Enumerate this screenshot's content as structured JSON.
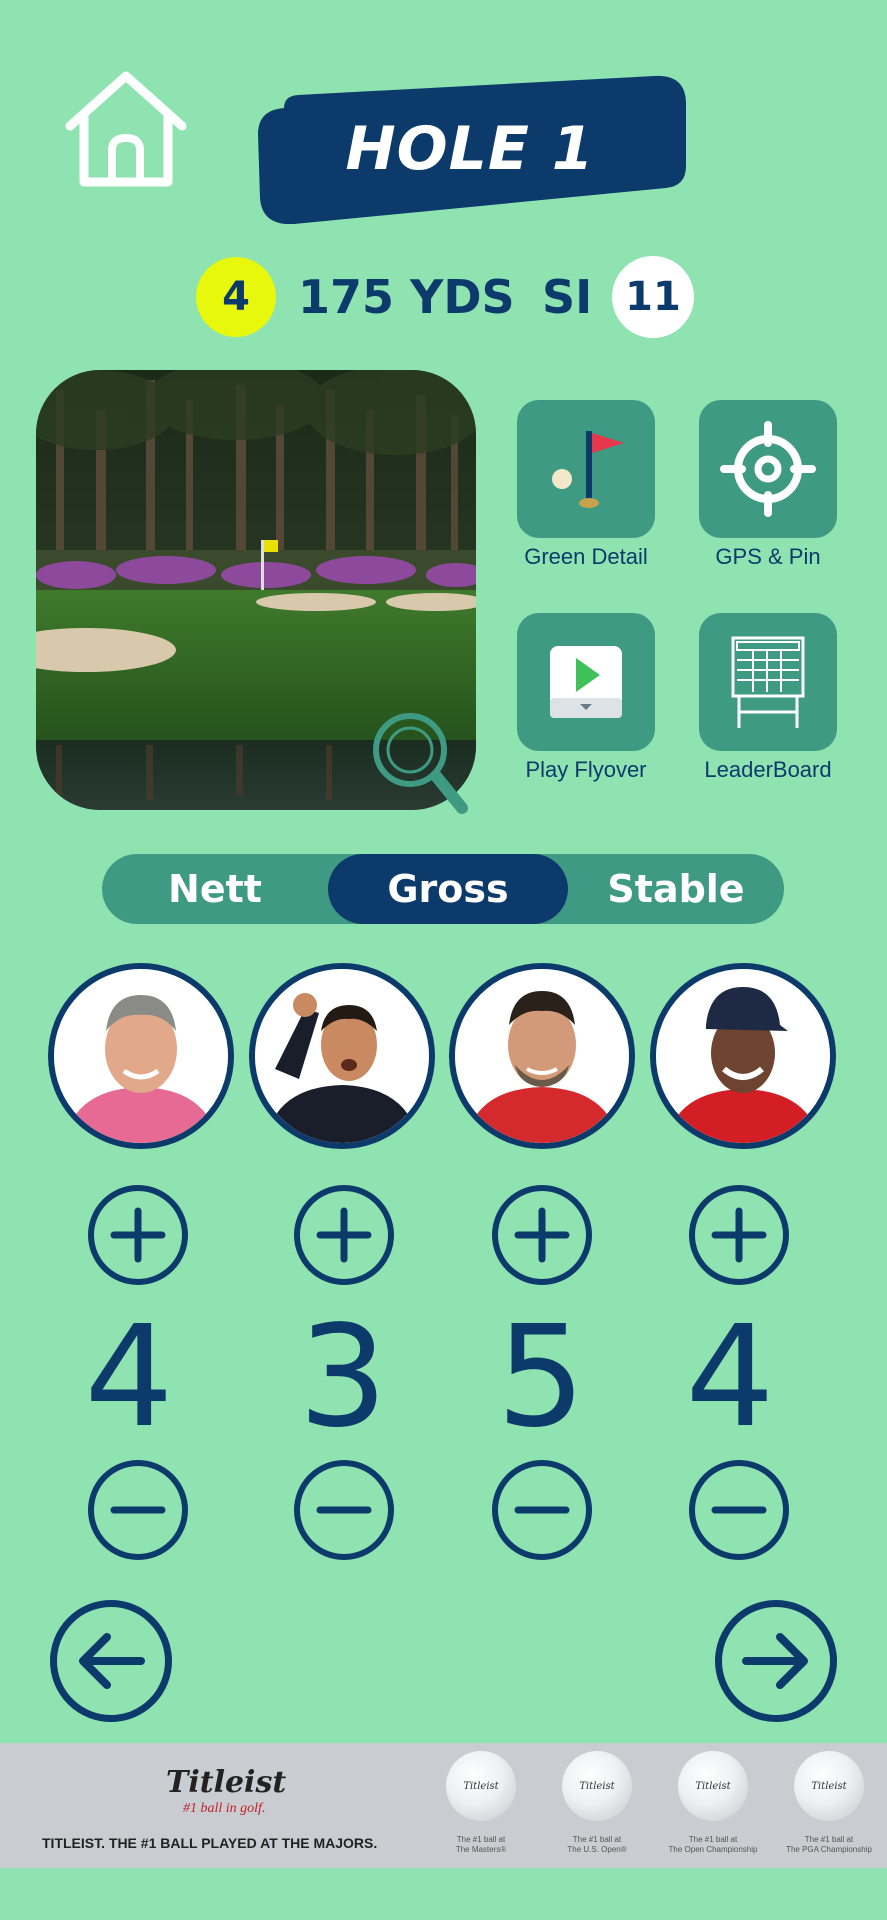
{
  "header": {
    "title": "HOLE 1",
    "par": "4",
    "yards": "175 YDS",
    "si_label": "SI",
    "si_value": "11"
  },
  "tiles": [
    {
      "label": "Green Detail",
      "icon": "flag-icon"
    },
    {
      "label": "GPS & Pin",
      "icon": "crosshair-icon"
    },
    {
      "label": "Play Flyover",
      "icon": "play-icon"
    },
    {
      "label": "LeaderBoard",
      "icon": "leaderboard-icon"
    }
  ],
  "segments": {
    "options": [
      "Nett",
      "Gross",
      "Stable"
    ],
    "selected": "Gross"
  },
  "players": [
    {
      "score": "4"
    },
    {
      "score": "3"
    },
    {
      "score": "5"
    },
    {
      "score": "4"
    }
  ],
  "footer": {
    "brand": "Titleist",
    "tagline": "#1 ball in golf.",
    "slogan": "TITLEIST. THE #1 BALL PLAYED AT THE MAJORS.",
    "balls": [
      {
        "line1": "The #1 ball at",
        "line2": "The Masters®"
      },
      {
        "line1": "The #1 ball at",
        "line2": "The U.S. Open®"
      },
      {
        "line1": "The #1 ball at",
        "line2": "The Open Championship"
      },
      {
        "line1": "The #1 ball at",
        "line2": "The PGA Championship"
      }
    ]
  },
  "colors": {
    "background": "#8ee3b0",
    "navy": "#0c3a6b",
    "tile": "#3f9a83",
    "par_badge": "#e8f80d"
  }
}
